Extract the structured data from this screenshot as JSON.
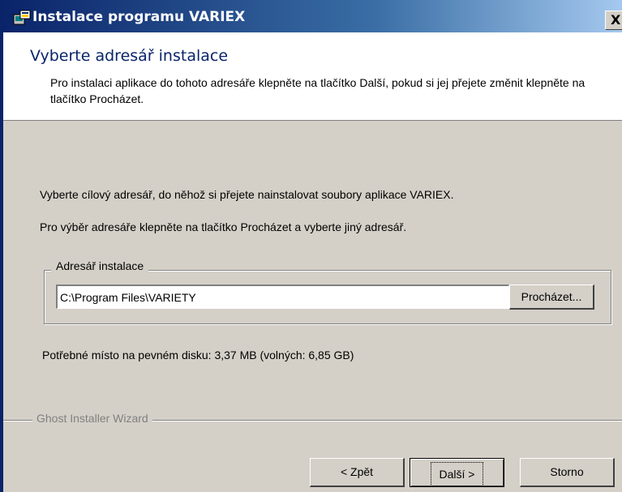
{
  "window": {
    "title": "Instalace programu VARIEX",
    "close_label": "X",
    "app_icon": "installer-icon"
  },
  "header": {
    "title": "Vyberte adresář instalace",
    "description": "Pro instalaci aplikace do tohoto adresáře klepněte na tlačítko Další, pokud si jej přejete změnit klepněte na tlačítko Procházet."
  },
  "body": {
    "line1": "Vyberte cílový adresář, do něhož si přejete nainstalovat soubory aplikace VARIEX.",
    "line2": "Pro výběr adresáře klepněte na tlačítko Procházet a vyberte jiný adresář."
  },
  "install_dir": {
    "group_label": "Adresář instalace",
    "path_value": "C:\\Program Files\\VARIETY",
    "browse_label": "Procházet..."
  },
  "disk_info": "Potřebné místo na pevném disku: 3,37 MB  (volných: 6,85 GB)",
  "footer": {
    "brand": "Ghost Installer Wizard",
    "back_label": "< Zpět",
    "next_label": "Další >",
    "cancel_label": "Storno"
  },
  "colors": {
    "title_bar": "#0a246a",
    "dialog_face": "#d4d0c8",
    "header_title": "#0a246a"
  }
}
